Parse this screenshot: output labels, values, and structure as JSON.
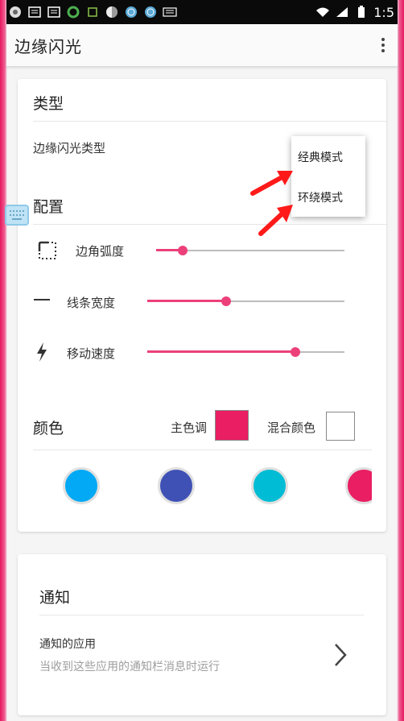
{
  "status_bar": {
    "time": "1:5",
    "icons": [
      "app-icon",
      "notification-icon",
      "notification-icon",
      "browser-icon",
      "usb-icon",
      "sync-icon",
      "globe-icon",
      "globe-icon",
      "keyboard-icon",
      "wifi-icon",
      "signal-icon",
      "battery-icon"
    ]
  },
  "app_bar": {
    "title": "边缘闪光"
  },
  "type_section": {
    "title": "类型",
    "type_label": "边缘闪光类型"
  },
  "popup": {
    "items": [
      "经典模式",
      "环绕模式"
    ]
  },
  "config_section": {
    "title": "配置",
    "corner_radius": {
      "label": "边角弧度",
      "icon": "rounded-corner-icon",
      "value": 0.14
    },
    "line_width": {
      "label": "线条宽度",
      "icon": "line-width-icon",
      "value": 0.4
    },
    "move_speed": {
      "label": "移动速度",
      "icon": "lightning-icon",
      "value": 0.75
    }
  },
  "color_section": {
    "title": "颜色",
    "primary_label": "主色调",
    "primary_color": "#e91e63",
    "mix_label": "混合颜色",
    "mix_color": "#ffffff",
    "palette": [
      "#03a9f4",
      "#3f51b5",
      "#00bcd4",
      "#e91e63"
    ]
  },
  "notify_section": {
    "title": "通知",
    "apps_title": "通知的应用",
    "apps_subtitle": "当收到这些应用的通知栏消息时运行"
  },
  "colors": {
    "accent": "#ec407a",
    "frame": "#e91e63",
    "annotation_arrow": "#ff1a1a"
  }
}
